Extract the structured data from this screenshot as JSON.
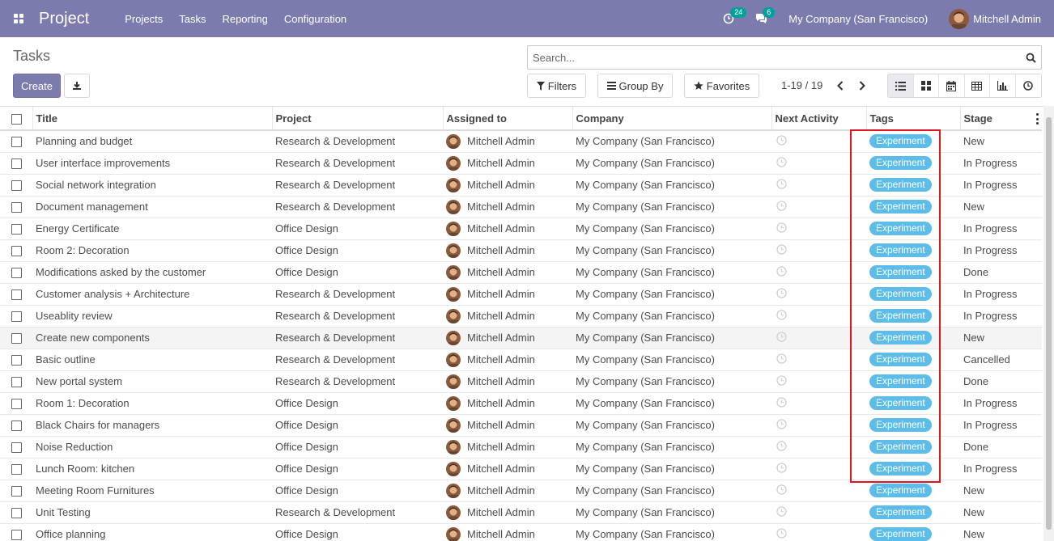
{
  "navbar": {
    "app_title": "Project",
    "menu": [
      "Projects",
      "Tasks",
      "Reporting",
      "Configuration"
    ],
    "activity_count": "24",
    "message_count": "6",
    "company": "My Company (San Francisco)",
    "user": "Mitchell Admin"
  },
  "control_panel": {
    "title": "Tasks",
    "create_label": "Create",
    "search_placeholder": "Search...",
    "filters_label": "Filters",
    "group_by_label": "Group By",
    "favorites_label": "Favorites",
    "pager": "1-19 / 19",
    "views": [
      "list-icon",
      "kanban-icon",
      "calendar-icon",
      "pivot-icon",
      "graph-icon",
      "activity-icon"
    ]
  },
  "table": {
    "columns": [
      "Title",
      "Project",
      "Assigned to",
      "Company",
      "Next Activity",
      "Tags",
      "Stage"
    ],
    "rows": [
      {
        "title": "Planning and budget",
        "project": "Research & Development",
        "assigned": "Mitchell Admin",
        "company": "My Company (San Francisco)",
        "tag": "Experiment",
        "stage": "New"
      },
      {
        "title": "User interface improvements",
        "project": "Research & Development",
        "assigned": "Mitchell Admin",
        "company": "My Company (San Francisco)",
        "tag": "Experiment",
        "stage": "In Progress"
      },
      {
        "title": "Social network integration",
        "project": "Research & Development",
        "assigned": "Mitchell Admin",
        "company": "My Company (San Francisco)",
        "tag": "Experiment",
        "stage": "In Progress"
      },
      {
        "title": "Document management",
        "project": "Research & Development",
        "assigned": "Mitchell Admin",
        "company": "My Company (San Francisco)",
        "tag": "Experiment",
        "stage": "New"
      },
      {
        "title": "Energy Certificate",
        "project": "Office Design",
        "assigned": "Mitchell Admin",
        "company": "My Company (San Francisco)",
        "tag": "Experiment",
        "stage": "In Progress"
      },
      {
        "title": "Room 2: Decoration",
        "project": "Office Design",
        "assigned": "Mitchell Admin",
        "company": "My Company (San Francisco)",
        "tag": "Experiment",
        "stage": "In Progress"
      },
      {
        "title": "Modifications asked by the customer",
        "project": "Office Design",
        "assigned": "Mitchell Admin",
        "company": "My Company (San Francisco)",
        "tag": "Experiment",
        "stage": "Done"
      },
      {
        "title": "Customer analysis + Architecture",
        "project": "Research & Development",
        "assigned": "Mitchell Admin",
        "company": "My Company (San Francisco)",
        "tag": "Experiment",
        "stage": "In Progress"
      },
      {
        "title": "Useablity review",
        "project": "Research & Development",
        "assigned": "Mitchell Admin",
        "company": "My Company (San Francisco)",
        "tag": "Experiment",
        "stage": "In Progress"
      },
      {
        "title": "Create new components",
        "project": "Research & Development",
        "assigned": "Mitchell Admin",
        "company": "My Company (San Francisco)",
        "tag": "Experiment",
        "stage": "New"
      },
      {
        "title": "Basic outline",
        "project": "Research & Development",
        "assigned": "Mitchell Admin",
        "company": "My Company (San Francisco)",
        "tag": "Experiment",
        "stage": "Cancelled"
      },
      {
        "title": "New portal system",
        "project": "Research & Development",
        "assigned": "Mitchell Admin",
        "company": "My Company (San Francisco)",
        "tag": "Experiment",
        "stage": "Done"
      },
      {
        "title": "Room 1: Decoration",
        "project": "Office Design",
        "assigned": "Mitchell Admin",
        "company": "My Company (San Francisco)",
        "tag": "Experiment",
        "stage": "In Progress"
      },
      {
        "title": "Black Chairs for managers",
        "project": "Office Design",
        "assigned": "Mitchell Admin",
        "company": "My Company (San Francisco)",
        "tag": "Experiment",
        "stage": "In Progress"
      },
      {
        "title": "Noise Reduction",
        "project": "Office Design",
        "assigned": "Mitchell Admin",
        "company": "My Company (San Francisco)",
        "tag": "Experiment",
        "stage": "Done"
      },
      {
        "title": "Lunch Room: kitchen",
        "project": "Office Design",
        "assigned": "Mitchell Admin",
        "company": "My Company (San Francisco)",
        "tag": "Experiment",
        "stage": "In Progress"
      },
      {
        "title": "Meeting Room Furnitures",
        "project": "Office Design",
        "assigned": "Mitchell Admin",
        "company": "My Company (San Francisco)",
        "tag": "Experiment",
        "stage": "New"
      },
      {
        "title": "Unit Testing",
        "project": "Research & Development",
        "assigned": "Mitchell Admin",
        "company": "My Company (San Francisco)",
        "tag": "Experiment",
        "stage": "New"
      },
      {
        "title": "Office planning",
        "project": "Office Design",
        "assigned": "Mitchell Admin",
        "company": "My Company (San Francisco)",
        "tag": "Experiment",
        "stage": "New"
      }
    ]
  },
  "colors": {
    "brand": "#7c7bad",
    "tag": "#5dbde8",
    "highlight": "#e0161f"
  }
}
